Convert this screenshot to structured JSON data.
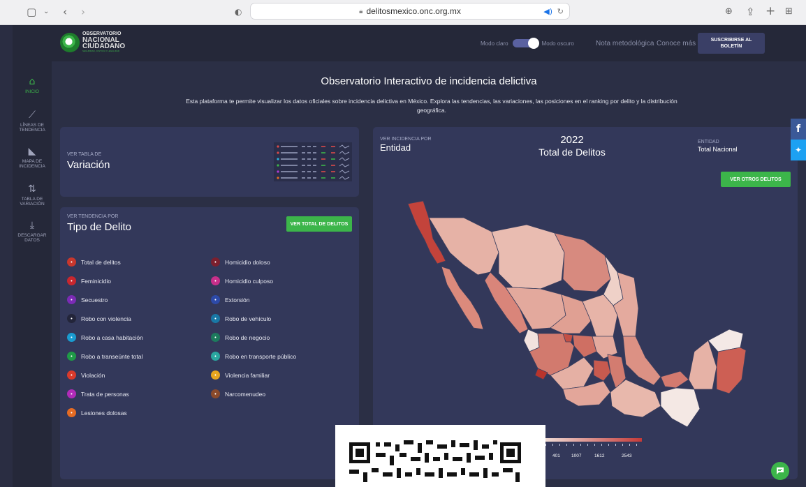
{
  "browser": {
    "url": "delitosmexico.onc.org.mx",
    "icons": [
      "sidebar-toggle-icon",
      "chevron-down-icon",
      "back-icon",
      "forward-icon",
      "shield-icon",
      "lock-icon",
      "audio-icon",
      "reload-icon",
      "download-icon",
      "share-icon",
      "new-tab-icon",
      "tab-overview-icon"
    ]
  },
  "logo": {
    "line1": "OBSERVATORIO",
    "line2": "NACIONAL",
    "line3": "CIUDADANO",
    "line4": "SEGURIDAD, JUSTICIA Y LEGALIDAD"
  },
  "nav": {
    "mode_light": "Modo claro",
    "mode_dark": "Modo oscuro",
    "dark_mode_on": true,
    "note": "Nota metodológica",
    "more": "Conoce más",
    "subscribe_line1": "SUSCRIBIRSE AL",
    "subscribe_line2": "BOLETÍN"
  },
  "sidebar": {
    "items": [
      {
        "label": "INICIO",
        "icon": "home-icon",
        "active": true
      },
      {
        "label1": "LÍNEAS DE",
        "label2": "TENDENCIA",
        "icon": "trend-line-icon"
      },
      {
        "label1": "MAPA DE",
        "label2": "INCIDENCIA",
        "icon": "map-icon"
      },
      {
        "label1": "TABLA DE",
        "label2": "VARIACIÓN",
        "icon": "sort-arrows-icon"
      },
      {
        "label1": "DESCARGAR",
        "label2": "DATOS",
        "icon": "download-icon"
      }
    ]
  },
  "hero": {
    "title": "Observatorio Interactivo de incidencia delictiva",
    "desc": "Esta plataforma te permite visualizar los datos oficiales sobre incidencia delictiva en México. Explora las tendencias, las variaciones, las posiciones en el ranking por delito y la distribución geográfica."
  },
  "variacion": {
    "kicker": "VER TABLA DE",
    "title": "Variación"
  },
  "tipo": {
    "kicker": "VER TENDENCIA POR",
    "title": "Tipo de Delito",
    "button": "VER TOTAL DE DELITOS",
    "left": [
      {
        "label": "Total de delitos",
        "color": "#c8372d",
        "icon": "total-crimes-icon"
      },
      {
        "label": "Feminicidio",
        "color": "#c8272f",
        "icon": "feminicide-icon"
      },
      {
        "label": "Secuestro",
        "color": "#7b2bb5",
        "icon": "kidnapping-icon"
      },
      {
        "label": "Robo con violencia",
        "color": "#23253a",
        "icon": "violent-robbery-icon"
      },
      {
        "label": "Robo a casa habitación",
        "color": "#1a9bd0",
        "icon": "house-robbery-icon"
      },
      {
        "label": "Robo a transeúnte total",
        "color": "#1f9a47",
        "icon": "pedestrian-robbery-icon"
      },
      {
        "label": "Violación",
        "color": "#d93a2b",
        "icon": "rape-icon"
      },
      {
        "label": "Trata de personas",
        "color": "#b12bb8",
        "icon": "trafficking-icon"
      },
      {
        "label": "Lesiones dolosas",
        "color": "#e56b23",
        "icon": "injury-icon"
      }
    ],
    "right": [
      {
        "label": "Homicidio doloso",
        "color": "#7b1f2e",
        "icon": "intentional-homicide-icon"
      },
      {
        "label": "Homicidio culposo",
        "color": "#c72f8a",
        "icon": "culpable-homicide-icon"
      },
      {
        "label": "Extorsión",
        "color": "#2d4aa8",
        "icon": "extortion-icon"
      },
      {
        "label": "Robo de vehículo",
        "color": "#1978a6",
        "icon": "vehicle-robbery-icon"
      },
      {
        "label": "Robo de negocio",
        "color": "#1d7a5d",
        "icon": "business-robbery-icon"
      },
      {
        "label": "Robo en transporte público",
        "color": "#2aa7a0",
        "icon": "transport-robbery-icon"
      },
      {
        "label": "Violencia familiar",
        "color": "#e8a41e",
        "icon": "family-violence-icon"
      },
      {
        "label": "Narcomenudeo",
        "color": "#8a4a2b",
        "icon": "drug-dealing-icon"
      }
    ]
  },
  "mapcard": {
    "kicker": "VER INCIDENCIA POR",
    "title": "Entidad",
    "year": "2022",
    "subtitle": "Total de Delitos",
    "entity_kicker": "ENTIDAD",
    "entity": "Total Nacional",
    "button": "VER OTROS DELITOS",
    "legend": [
      "401",
      "1007",
      "1612",
      "2543"
    ]
  },
  "social": {
    "facebook": "f",
    "twitter": "twitter-bird-icon"
  }
}
